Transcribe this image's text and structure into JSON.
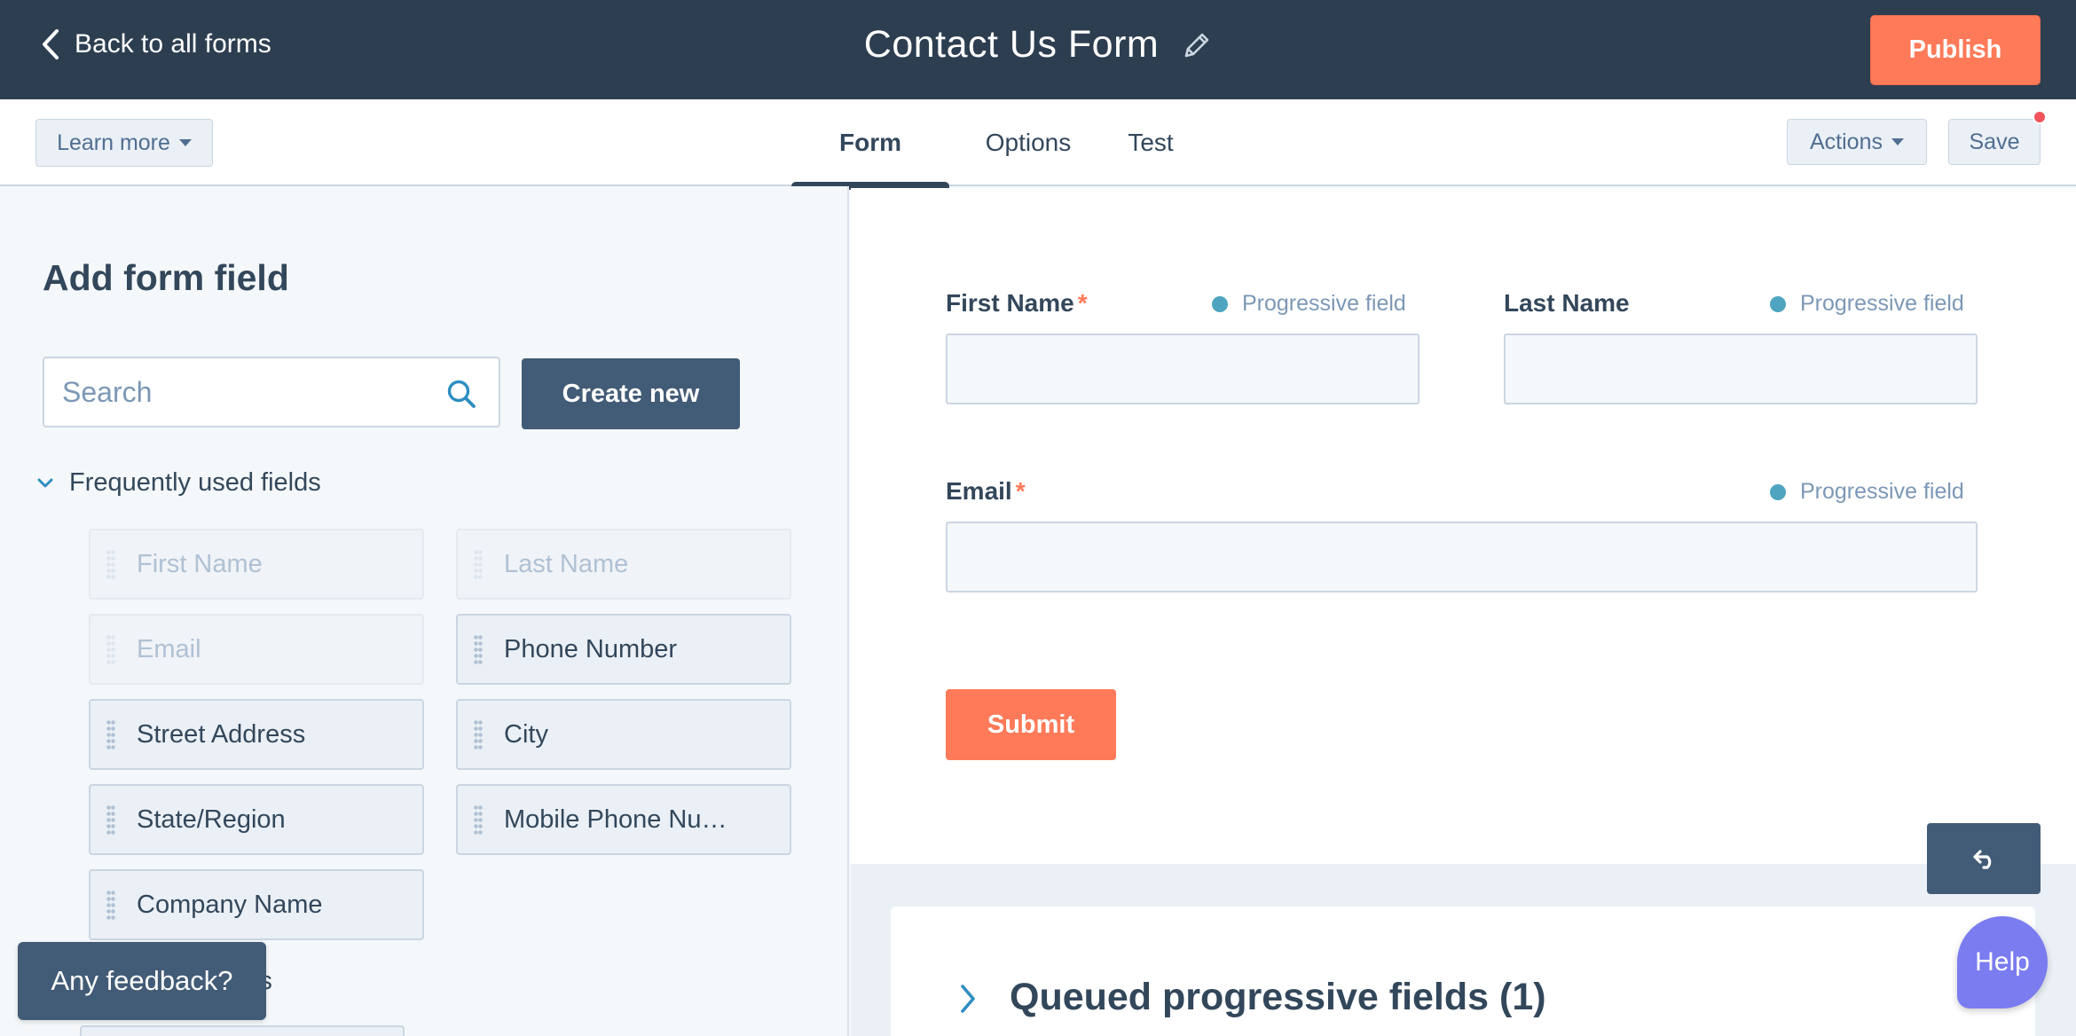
{
  "topbar": {
    "back_label": "Back to all forms",
    "form_title": "Contact Us Form",
    "publish_label": "Publish"
  },
  "subbar": {
    "learn_more_label": "Learn more",
    "tabs": [
      {
        "label": "Form",
        "active": true
      },
      {
        "label": "Options",
        "active": false
      },
      {
        "label": "Test",
        "active": false
      }
    ],
    "actions_label": "Actions",
    "save_label": "Save"
  },
  "left_panel": {
    "heading": "Add form field",
    "search_placeholder": "Search",
    "create_new_label": "Create new",
    "section_label": "Frequently used fields",
    "fields": [
      {
        "label": "First Name",
        "disabled": true
      },
      {
        "label": "Last Name",
        "disabled": true
      },
      {
        "label": "Email",
        "disabled": true
      },
      {
        "label": "Phone Number",
        "disabled": false
      },
      {
        "label": "Street Address",
        "disabled": false
      },
      {
        "label": "City",
        "disabled": false
      },
      {
        "label": "State/Region",
        "disabled": false
      },
      {
        "label": "Mobile Phone Nu…",
        "disabled": false
      },
      {
        "label": "Company Name",
        "disabled": false
      }
    ],
    "next_section_partial": "ents",
    "feedback_label": "Any feedback?"
  },
  "form_preview": {
    "fields": [
      {
        "label": "First Name",
        "required": true,
        "progressive_label": "Progressive field"
      },
      {
        "label": "Last Name",
        "required": false,
        "progressive_label": "Progressive field"
      },
      {
        "label": "Email",
        "required": true,
        "progressive_label": "Progressive field"
      }
    ],
    "required_marker": "*",
    "submit_label": "Submit"
  },
  "queued": {
    "title": "Queued progressive fields (1)"
  },
  "help_label": "Help",
  "colors": {
    "topbar": "#2d3e50",
    "accent": "#ff7a59",
    "primary_dark": "#425b76",
    "progressive_dot": "#4fa5bf",
    "help": "#7b7cf0",
    "unsaved_dot": "#f2545b"
  },
  "icons": {
    "back": "chevron-left-icon",
    "edit_title": "pencil-icon",
    "search": "search-icon",
    "section_toggle": "chevron-down-icon",
    "drag": "drag-handle-icon",
    "undo": "undo-icon",
    "queued_toggle": "chevron-right-icon"
  }
}
